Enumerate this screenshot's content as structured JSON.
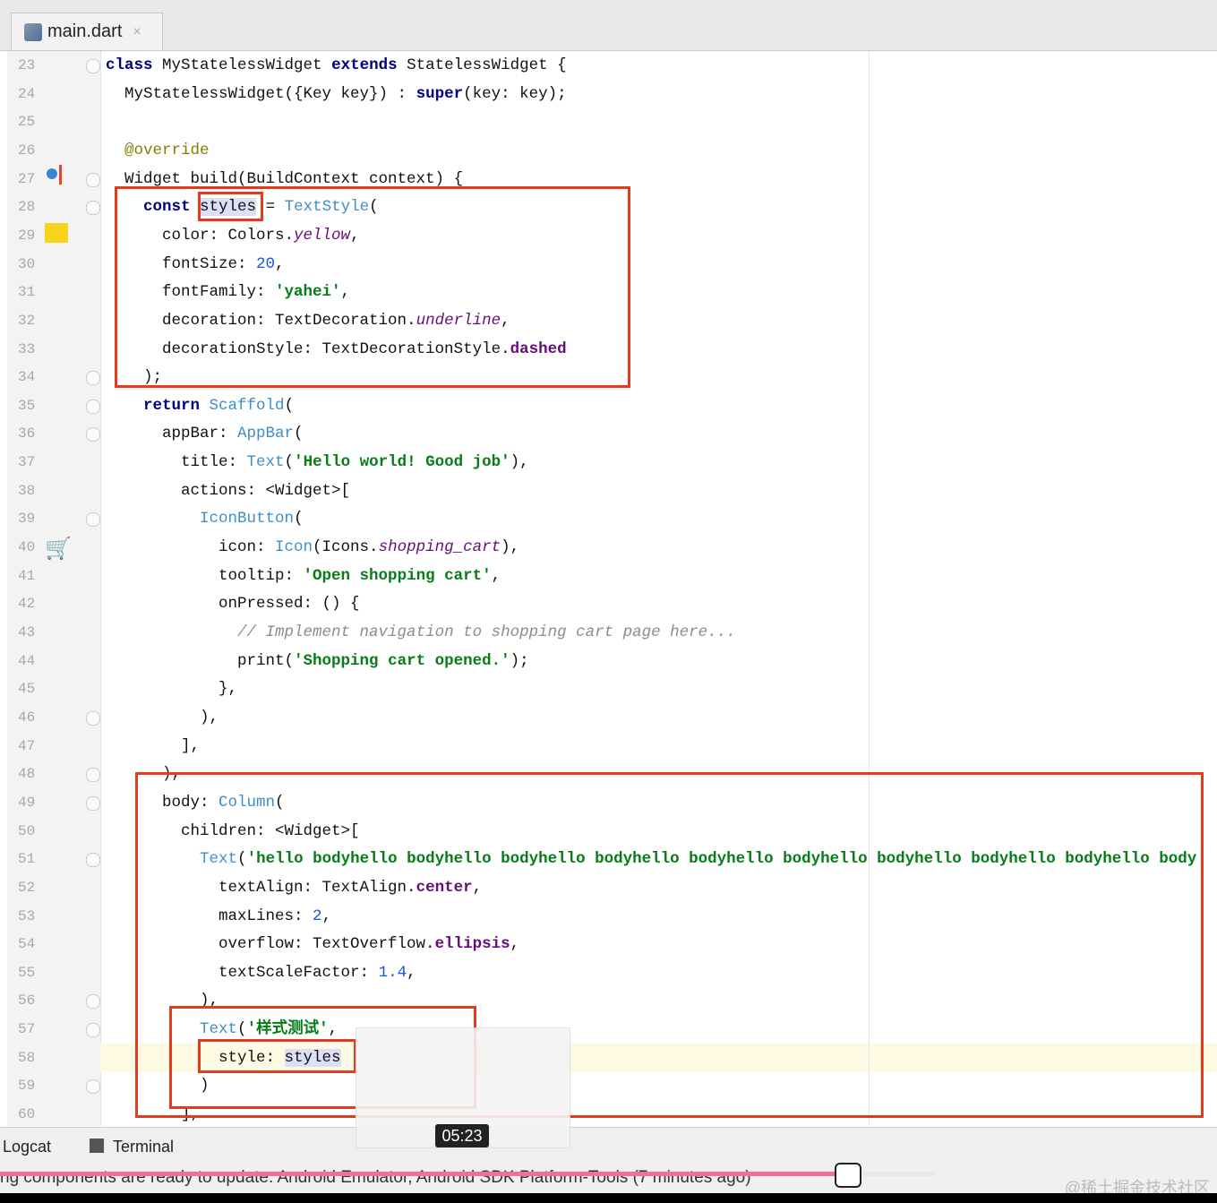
{
  "tab": {
    "title": "main.dart",
    "close": "×"
  },
  "code_lines": [
    {
      "n": "23",
      "t": [
        [
          "class",
          "kw"
        ],
        [
          " MyStatelessWidget ",
          ""
        ],
        [
          "extends",
          "kw"
        ],
        [
          " StatelessWidget {",
          ""
        ]
      ]
    },
    {
      "n": "24",
      "t": [
        [
          "  MyStatelessWidget({Key key}) : ",
          ""
        ],
        [
          "super",
          "kw"
        ],
        [
          "(key: key);",
          ""
        ]
      ]
    },
    {
      "n": "25",
      "t": []
    },
    {
      "n": "26",
      "t": [
        [
          "  ",
          ""
        ],
        [
          "@override",
          "ann"
        ]
      ]
    },
    {
      "n": "27",
      "t": [
        [
          "  Widget build(BuildContext context) {",
          ""
        ]
      ]
    },
    {
      "n": "28",
      "t": [
        [
          "    ",
          ""
        ],
        [
          "const",
          "kw"
        ],
        [
          " ",
          ""
        ],
        [
          "styles",
          "sel"
        ],
        [
          " = ",
          ""
        ],
        [
          "TextStyle",
          "cls"
        ],
        [
          "(",
          ""
        ]
      ]
    },
    {
      "n": "29",
      "t": [
        [
          "      color: Colors.",
          ""
        ],
        [
          "yellow",
          "it"
        ],
        [
          ",",
          ""
        ]
      ]
    },
    {
      "n": "30",
      "t": [
        [
          "      fontSize: ",
          ""
        ],
        [
          "20",
          "num"
        ],
        [
          ",",
          ""
        ]
      ]
    },
    {
      "n": "31",
      "t": [
        [
          "      fontFamily: ",
          ""
        ],
        [
          "'yahei'",
          "str"
        ],
        [
          ",",
          ""
        ]
      ]
    },
    {
      "n": "32",
      "t": [
        [
          "      decoration: TextDecoration.",
          ""
        ],
        [
          "underline",
          "it"
        ],
        [
          ",",
          ""
        ]
      ]
    },
    {
      "n": "33",
      "t": [
        [
          "      decorationStyle: TextDecorationStyle.",
          ""
        ],
        [
          "dashed",
          "en"
        ]
      ]
    },
    {
      "n": "34",
      "t": [
        [
          "    );",
          ""
        ]
      ]
    },
    {
      "n": "35",
      "t": [
        [
          "    ",
          ""
        ],
        [
          "return",
          "kw"
        ],
        [
          " ",
          ""
        ],
        [
          "Scaffold",
          "cls"
        ],
        [
          "(",
          ""
        ]
      ]
    },
    {
      "n": "36",
      "t": [
        [
          "      appBar: ",
          ""
        ],
        [
          "AppBar",
          "cls"
        ],
        [
          "(",
          ""
        ]
      ]
    },
    {
      "n": "37",
      "t": [
        [
          "        title: ",
          ""
        ],
        [
          "Text",
          "cls"
        ],
        [
          "(",
          ""
        ],
        [
          "'Hello world! Good job'",
          "str"
        ],
        [
          "),",
          ""
        ]
      ]
    },
    {
      "n": "38",
      "t": [
        [
          "        actions: <Widget>[",
          ""
        ]
      ]
    },
    {
      "n": "39",
      "t": [
        [
          "          ",
          ""
        ],
        [
          "IconButton",
          "cls"
        ],
        [
          "(",
          ""
        ]
      ]
    },
    {
      "n": "40",
      "t": [
        [
          "            icon: ",
          ""
        ],
        [
          "Icon",
          "cls"
        ],
        [
          "(Icons.",
          ""
        ],
        [
          "shopping_cart",
          "it"
        ],
        [
          "),",
          ""
        ]
      ]
    },
    {
      "n": "41",
      "t": [
        [
          "            tooltip: ",
          ""
        ],
        [
          "'Open shopping cart'",
          "str"
        ],
        [
          ",",
          ""
        ]
      ]
    },
    {
      "n": "42",
      "t": [
        [
          "            onPressed: () {",
          ""
        ]
      ]
    },
    {
      "n": "43",
      "t": [
        [
          "              ",
          ""
        ],
        [
          "// Implement navigation to shopping cart page here...",
          "cmt"
        ]
      ]
    },
    {
      "n": "44",
      "t": [
        [
          "              print(",
          ""
        ],
        [
          "'Shopping cart opened.'",
          "str"
        ],
        [
          ");",
          ""
        ]
      ]
    },
    {
      "n": "45",
      "t": [
        [
          "            },",
          ""
        ]
      ]
    },
    {
      "n": "46",
      "t": [
        [
          "          ),",
          ""
        ]
      ]
    },
    {
      "n": "47",
      "t": [
        [
          "        ],",
          ""
        ]
      ]
    },
    {
      "n": "48",
      "t": [
        [
          "      ),",
          ""
        ]
      ]
    },
    {
      "n": "49",
      "t": [
        [
          "      body: ",
          ""
        ],
        [
          "Column",
          "cls"
        ],
        [
          "(",
          ""
        ]
      ]
    },
    {
      "n": "50",
      "t": [
        [
          "        children: <Widget>[",
          ""
        ]
      ]
    },
    {
      "n": "51",
      "t": [
        [
          "          ",
          ""
        ],
        [
          "Text",
          "cls"
        ],
        [
          "(",
          ""
        ],
        [
          "'hello bodyhello bodyhello bodyhello bodyhello bodyhello bodyhello bodyhello bodyhello bodyhello body",
          "str"
        ]
      ]
    },
    {
      "n": "52",
      "t": [
        [
          "            textAlign: TextAlign.",
          ""
        ],
        [
          "center",
          "en"
        ],
        [
          ",",
          ""
        ]
      ]
    },
    {
      "n": "53",
      "t": [
        [
          "            maxLines: ",
          ""
        ],
        [
          "2",
          "num"
        ],
        [
          ",",
          ""
        ]
      ]
    },
    {
      "n": "54",
      "t": [
        [
          "            overflow: TextOverflow.",
          ""
        ],
        [
          "ellipsis",
          "en"
        ],
        [
          ",",
          ""
        ]
      ]
    },
    {
      "n": "55",
      "t": [
        [
          "            textScaleFactor: ",
          ""
        ],
        [
          "1.4",
          "num"
        ],
        [
          ",",
          ""
        ]
      ]
    },
    {
      "n": "56",
      "t": [
        [
          "          ),",
          ""
        ]
      ]
    },
    {
      "n": "57",
      "t": [
        [
          "          ",
          ""
        ],
        [
          "Text",
          "cls"
        ],
        [
          "(",
          ""
        ],
        [
          "'样式测试'",
          "str"
        ],
        [
          ",",
          ""
        ]
      ]
    },
    {
      "n": "58",
      "t": [
        [
          "            style: ",
          ""
        ],
        [
          "styles",
          "sel"
        ]
      ]
    },
    {
      "n": "59",
      "t": [
        [
          "          )",
          ""
        ]
      ]
    },
    {
      "n": "60",
      "t": [
        [
          "        ],",
          ""
        ]
      ]
    }
  ],
  "toolbar": {
    "logcat": "Logcat",
    "terminal": "Terminal"
  },
  "status": {
    "message": "ng components are ready to update: Android Emulator, Android SDK Platform-Tools (7 minutes ago)"
  },
  "video": {
    "timestamp": "05:23",
    "progress_percent": 69.5
  },
  "watermark": "@稀土掘金技术社区",
  "colors": {
    "highlight_box": "#e53a1e",
    "keyword": "#000080",
    "string": "#067d17",
    "progress": "#f0709a"
  }
}
